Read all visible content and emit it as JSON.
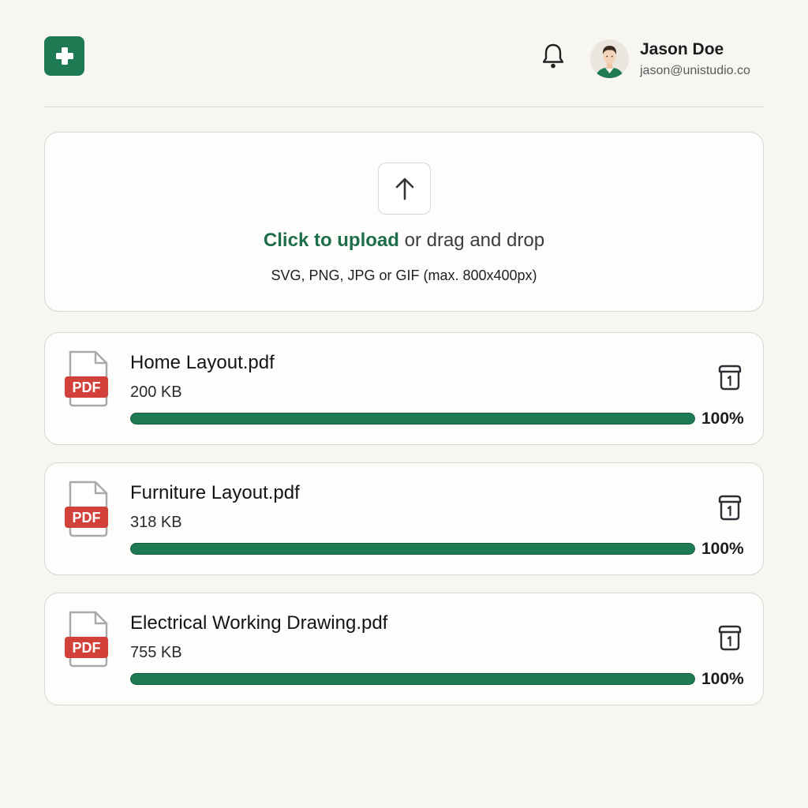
{
  "header": {
    "logo_icon": "plus-icon",
    "notification_icon": "bell-icon",
    "user": {
      "name": "Jason Doe",
      "email": "jason@unistudio.co"
    }
  },
  "upload": {
    "icon": "arrow-up-icon",
    "link_text": "Click to upload",
    "rest_text": "or drag and drop",
    "hint": "SVG, PNG, JPG or GIF (max. 800x400px)"
  },
  "files": [
    {
      "name": "Home Layout.pdf",
      "size": "200 KB",
      "progress": 100,
      "progress_label": "100%",
      "type_badge": "PDF"
    },
    {
      "name": "Furniture Layout.pdf",
      "size": "318 KB",
      "progress": 100,
      "progress_label": "100%",
      "type_badge": "PDF"
    },
    {
      "name": "Electrical Working Drawing.pdf",
      "size": "755 KB",
      "progress": 100,
      "progress_label": "100%",
      "type_badge": "PDF"
    }
  ],
  "colors": {
    "accent": "#1e7a53",
    "link": "#1e6e4a",
    "pdf_badge": "#d2403a",
    "background": "#f8f6f3"
  }
}
